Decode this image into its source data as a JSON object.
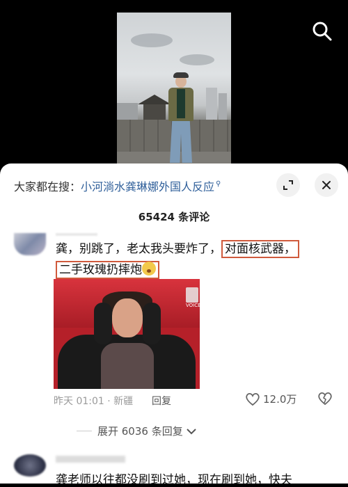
{
  "search": {
    "prefix": "大家都在搜：",
    "query": "小河淌水龚琳娜外国人反应"
  },
  "comments_header": {
    "count_label": "65424 条评论"
  },
  "comment1": {
    "text_plain": "龚，别跳了，老太我头要炸了，",
    "text_boxed_1": "对面核武器，",
    "text_boxed_2": "二手玫瑰扔摔炮",
    "emoji_icon": "astonished-face-emoji",
    "image_logo": "VOICE",
    "time": "昨天 01:01",
    "location": "新疆",
    "reply_label": "回复",
    "likes": "12.0万",
    "expand_label": "展开 6036 条回复"
  },
  "comment2": {
    "text": "龚老师以往都没刷到过她，现在刷到她，快夫"
  },
  "colors": {
    "highlight_box": "#d05a3c",
    "search_link": "#2f5f9a"
  }
}
